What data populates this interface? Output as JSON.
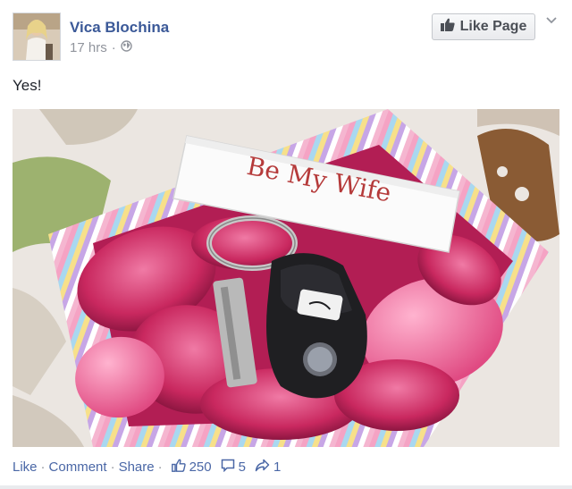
{
  "post": {
    "author": "Vica Blochina",
    "time": "17 hrs",
    "meta_sep": "·",
    "status": "Yes!",
    "like_page_label": "Like Page",
    "note_text": "Be My Wife"
  },
  "actions": {
    "like": "Like",
    "comment": "Comment",
    "share": "Share",
    "sep": "·",
    "likes_count": "250",
    "comments_count": "5",
    "shares_count": "1"
  },
  "icons": {
    "globe": "globe-icon",
    "thumbs_up": "thumbs-up-icon",
    "comment": "comment-icon",
    "share": "share-icon",
    "chevron": "chevron-down-icon"
  },
  "colors": {
    "link_blue": "#3b5998",
    "action_blue": "#4a67a6",
    "meta_gray": "#90949c",
    "petal_pink": "#d8336c"
  }
}
